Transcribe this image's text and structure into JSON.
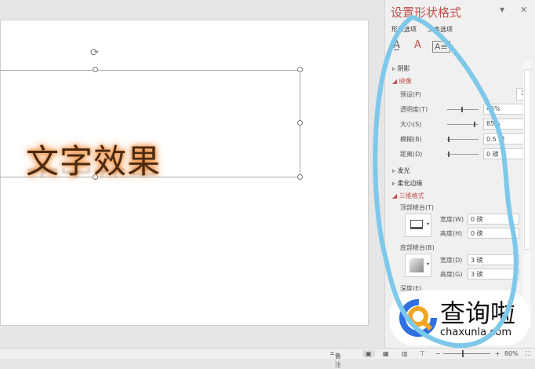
{
  "slide": {
    "wordart_text": "文字效果"
  },
  "panel": {
    "title": "设置形状格式",
    "tabs": [
      "形状选项",
      "文本选项"
    ],
    "sections": {
      "shadow": "阴影",
      "reflection": "映像",
      "glow": "发光",
      "soft_edges": "柔化边缘",
      "format_3d": "三维格式"
    },
    "reflection": {
      "preset": "预设(P)",
      "transparency_label": "透明度(T)",
      "transparency": "45%",
      "size_label": "大小(S)",
      "size": "85%",
      "blur_label": "模糊(B)",
      "blur": "0.5 磅",
      "distance_label": "距离(D)",
      "distance": "0 磅"
    },
    "format3d": {
      "top_bevel": "顶部棱台(T)",
      "top_width_label": "宽度(W)",
      "top_width": "0 磅",
      "top_height_label": "高度(H)",
      "top_height": "0 磅",
      "bottom_bevel": "底部棱台(B)",
      "bottom_width_label": "宽度(D)",
      "bottom_width": "3 磅",
      "bottom_height_label": "高度(G)",
      "bottom_height": "3 磅",
      "depth_label": "深度(E)"
    }
  },
  "status": {
    "notes": "备注",
    "zoom": "80%"
  },
  "watermark": {
    "name": "查询啦",
    "url": "chaxunla.com"
  },
  "colors": {
    "accent": "#c0504d",
    "annotation": "#7ec8ea"
  }
}
